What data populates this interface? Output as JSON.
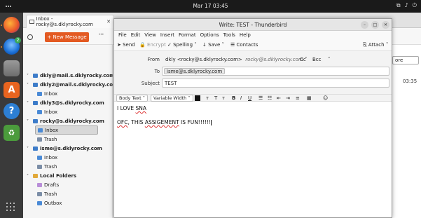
{
  "topbar": {
    "clock": "Mar 17  03:45"
  },
  "colors": {
    "accent": "#e35a22",
    "dock": "#3a3a3a",
    "topbar": "#1a1a1a"
  },
  "dock": {
    "apps": [
      {
        "name": "firefox-icon"
      },
      {
        "name": "thunderbird-icon",
        "badge": "2"
      },
      {
        "name": "files-icon"
      },
      {
        "name": "app-center-icon"
      },
      {
        "name": "help-icon"
      },
      {
        "name": "trash-icon"
      }
    ]
  },
  "main": {
    "tab_label": "Inbox - rocky@s.dklyrocky.com",
    "new_message_label": "+ New Message",
    "right_select": "ore",
    "right_time": "03:35"
  },
  "folders": [
    {
      "label": "dkly@mail.s.dklyrocky.com",
      "type": "account"
    },
    {
      "label": "dkly2@mail.s.dklyrocky.com",
      "type": "account"
    },
    {
      "label": "Inbox",
      "type": "inbox"
    },
    {
      "label": "dkly3@s.dklyrocky.com",
      "type": "account"
    },
    {
      "label": "Inbox",
      "type": "inbox"
    },
    {
      "label": "rocky@s.dklyrocky.com",
      "type": "account"
    },
    {
      "label": "Inbox",
      "type": "inbox",
      "selected": true
    },
    {
      "label": "Trash",
      "type": "trash"
    },
    {
      "label": "isme@s.dklyrocky.com",
      "type": "account"
    },
    {
      "label": "Inbox",
      "type": "inbox"
    },
    {
      "label": "Trash",
      "type": "trash"
    },
    {
      "label": "Local Folders",
      "type": "account"
    },
    {
      "label": "Drafts",
      "type": "drafts"
    },
    {
      "label": "Trash",
      "type": "trash"
    },
    {
      "label": "Outbox",
      "type": "outbox"
    }
  ],
  "compose": {
    "title": "Write: TEST - Thunderbird",
    "menu": [
      "File",
      "Edit",
      "View",
      "Insert",
      "Format",
      "Options",
      "Tools",
      "Help"
    ],
    "toolbar": {
      "send": "Send",
      "encrypt": "Encrypt",
      "spelling": "Spelling",
      "save": "Save",
      "contacts": "Contacts",
      "attach": "Attach"
    },
    "from_label": "From",
    "from_value": "dkly <rocky@s.dklyrocky.com>",
    "from_alias": "rocky@s.dklyrocky.com",
    "cc": "Cc",
    "bcc": "Bcc",
    "to_label": "To",
    "to_value": "isme@s.dklyrocky.com",
    "subject_label": "Subject",
    "subject_value": "TEST",
    "format_para": "Body Text",
    "format_font": "Variable Width",
    "body": {
      "line1_a": "I LOVE ",
      "line1_b": "SNA",
      "line2_a": "OFC",
      "line2_b": ", THIS ",
      "line2_c": "ASSIGEMENT",
      "line2_d": " IS FUN!!!!!!"
    }
  }
}
